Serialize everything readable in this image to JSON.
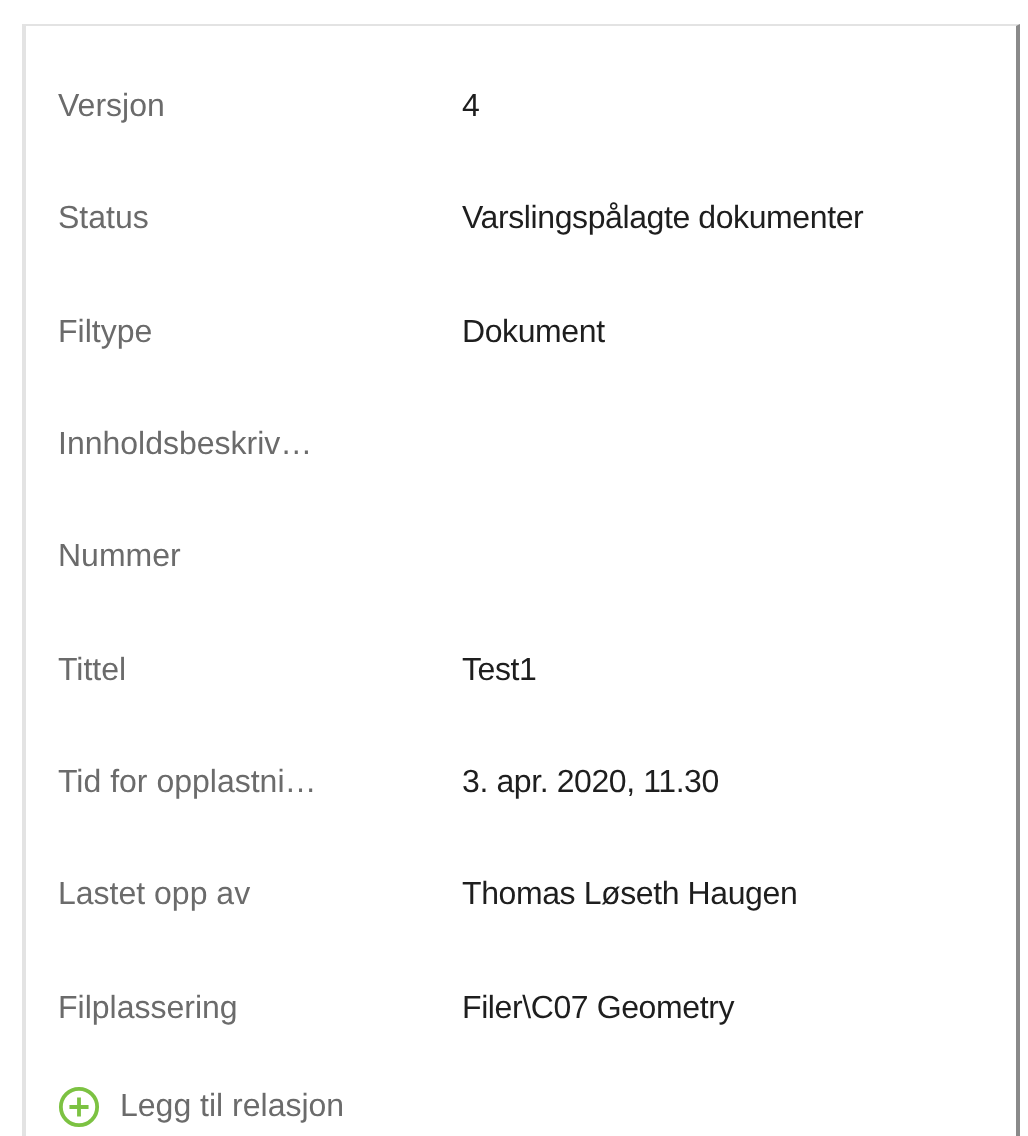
{
  "properties": [
    {
      "label": "Versjon",
      "value": "4"
    },
    {
      "label": "Status",
      "value": "Varslingspålagte dokumenter"
    },
    {
      "label": "Filtype",
      "value": "Dokument"
    },
    {
      "label": "Innholdsbeskriv…"
    },
    {
      "label": "Nummer"
    },
    {
      "label": "Tittel",
      "value": "Test1"
    },
    {
      "label": "Tid for opplastni…",
      "value": "3. apr. 2020, 11.30"
    },
    {
      "label": "Lastet opp av",
      "value": "Thomas Løseth Haugen"
    },
    {
      "label": "Filplassering",
      "value": "Filer\\C07 Geometry"
    }
  ],
  "add_relation": {
    "label": "Legg til relasjon"
  }
}
